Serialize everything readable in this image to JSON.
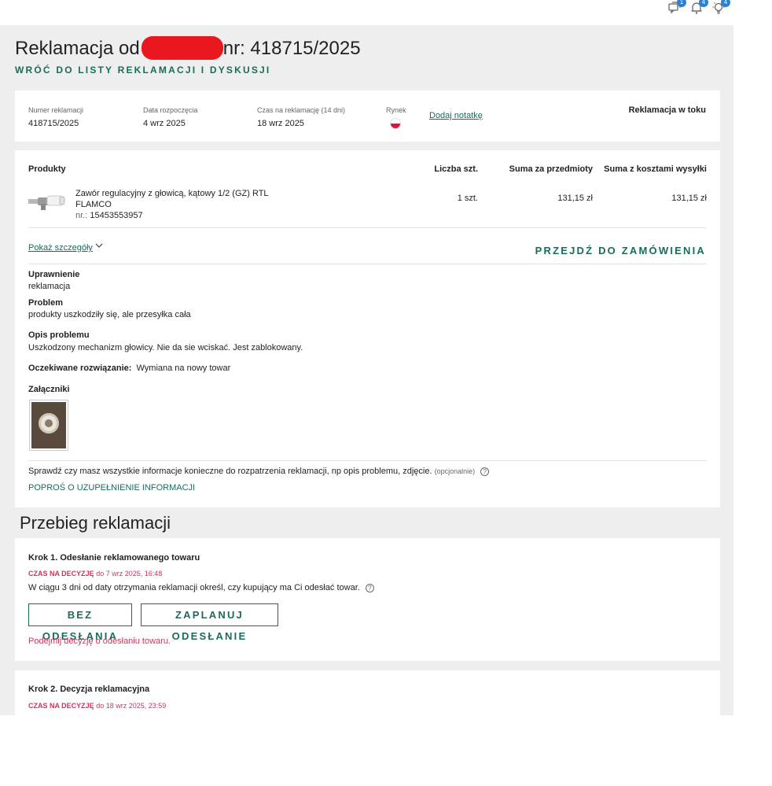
{
  "topbar": {
    "icons": [
      {
        "name": "messages-icon",
        "badge": "1"
      },
      {
        "name": "notifications-icon",
        "badge": "4"
      },
      {
        "name": "tips-icon",
        "badge": "4"
      }
    ]
  },
  "header": {
    "title_prefix": "Reklamacja od",
    "title_suffix": "nr: 418715/2025",
    "back_link": "WRÓĆ DO LISTY REKLAMACJI I DYSKUSJI"
  },
  "summary": {
    "fields": [
      {
        "label": "Numer reklamacji",
        "value": "418715/2025"
      },
      {
        "label": "Data rozpoczęcia",
        "value": "4 wrz 2025"
      },
      {
        "label": "Czas na reklamację (14 dni)",
        "value": "18 wrz 2025"
      }
    ],
    "market_label": "Rynek",
    "add_note": "Dodaj notatkę",
    "status": "Reklamacja w toku"
  },
  "products": {
    "headers": {
      "product": "Produkty",
      "qty": "Liczba szt.",
      "items_sum": "Suma za przedmioty",
      "total_sum": "Suma z kosztami wysyłki"
    },
    "items": [
      {
        "name_line1": "Zawór regulacyjny z głowicą, kątowy 1/2 (GZ) RTL",
        "name_line2": "FLAMCO",
        "nr_label": "nr.:",
        "nr": "15453553957",
        "qty": "1 szt.",
        "items_sum": "131,15 zł",
        "total_sum": "131,15 zł"
      }
    ],
    "show_details": "Pokaż szczegóły",
    "goto_order": "PRZEJDŹ DO ZAMÓWIENIA"
  },
  "details": {
    "entitlement_label": "Uprawnienie",
    "entitlement_value": "reklamacja",
    "problem_label": "Problem",
    "problem_value": "produkty uszkodziły się, ale przesyłka cała",
    "description_label": "Opis problemu",
    "description_value": "Uszkodzony mechanizm głowicy. Nie da sie wciskać. Jest zablokowany.",
    "expected_label": "Oczekiwane rozwiązanie:",
    "expected_value": "Wymiana na nowy towar",
    "attachments_label": "Załączniki",
    "check_text": "Sprawdź czy masz wszystkie informacje konieczne do rozpatrzenia reklamacji, np opis problemu, zdjęcie.",
    "optional": "(opcjonalnie)",
    "ask_info": "POPROŚ O UZUPEŁNIENIE INFORMACJI"
  },
  "process": {
    "title": "Przebieg reklamacji",
    "step1": {
      "title": "Krok 1. Odesłanie reklamowanego towaru",
      "deadline_label": "CZAS NA DECYZJĘ",
      "deadline_value": "do 7 wrz 2025, 16:48",
      "description": "W ciągu 3 dni od daty otrzymania reklamacji określ, czy kupujący ma Ci odesłać towar.",
      "btn_no_return": "BEZ ODESŁANIA",
      "btn_schedule": "ZAPLANUJ ODESŁANIE",
      "decide_text": "Podejmij decyzję o odesłaniu towaru."
    },
    "step2": {
      "title": "Krok 2. Decyzja reklamacyjna",
      "deadline_label": "CZAS NA DECYZJĘ",
      "deadline_value": "do 18 wrz 2025, 23:59"
    }
  },
  "colors": {
    "accent": "#1a6b5a",
    "deadline": "#d0345a",
    "badge": "#2c7fd1"
  }
}
